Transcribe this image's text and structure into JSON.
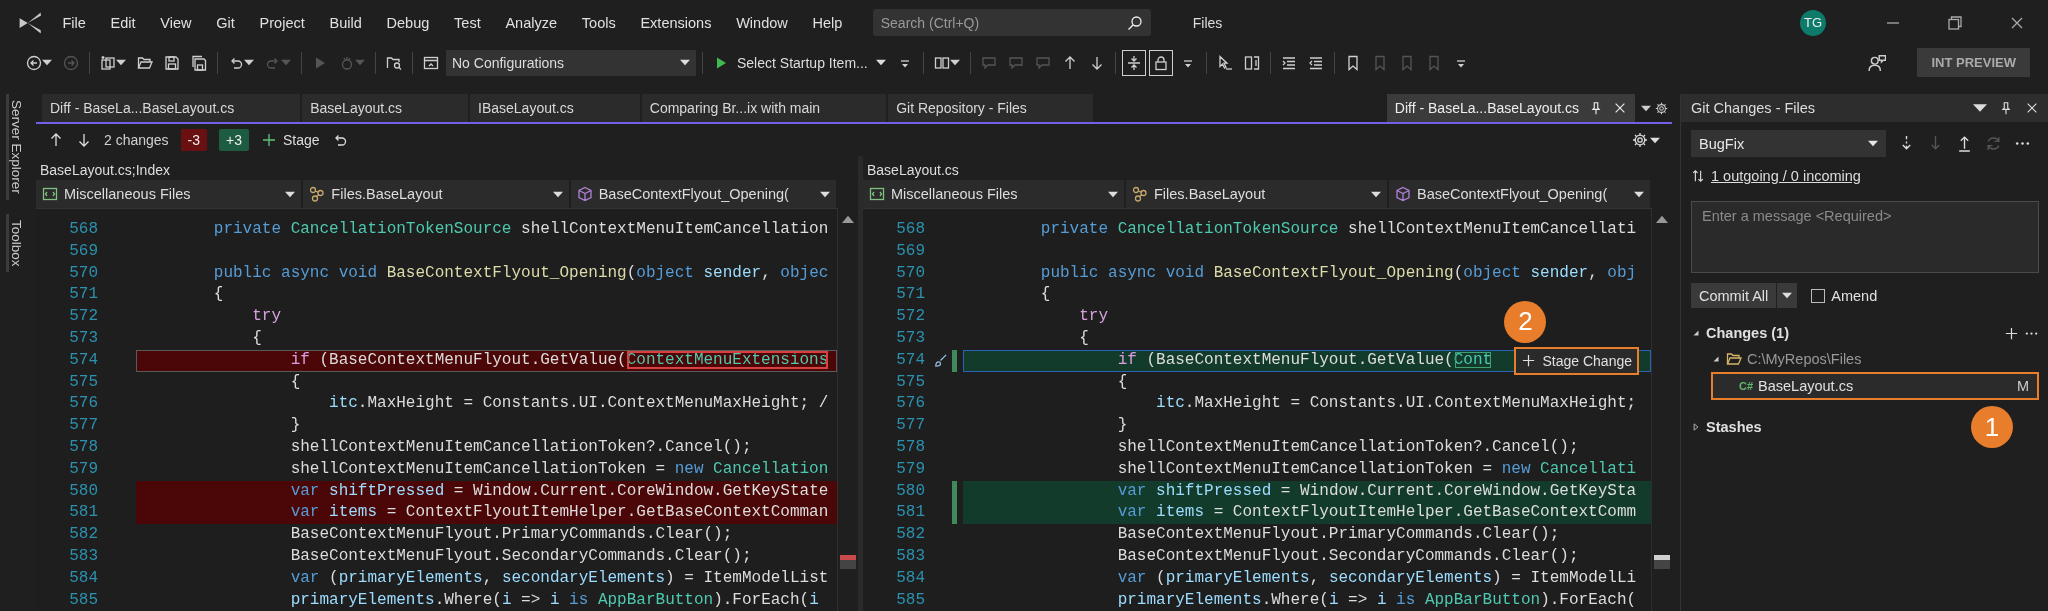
{
  "menu_bar": {
    "items": [
      "File",
      "Edit",
      "View",
      "Git",
      "Project",
      "Build",
      "Debug",
      "Test",
      "Analyze",
      "Tools",
      "Extensions",
      "Window",
      "Help"
    ],
    "search": {
      "placeholder": "Search (Ctrl+Q)"
    },
    "solution": "Files",
    "avatar": "TG"
  },
  "toolbar": {
    "items": [
      {
        "kind": "icon",
        "caret": true,
        "disabled": false
      },
      {
        "kind": "icon",
        "disabled": true
      },
      {
        "kind": "separator"
      },
      {
        "kind": "icon",
        "caret": true,
        "disabled": false
      },
      {
        "kind": "icon",
        "disabled": false
      },
      {
        "kind": "icon",
        "disabled": false
      },
      {
        "kind": "icon",
        "disabled": false
      },
      {
        "kind": "separator"
      },
      {
        "kind": "icon",
        "caret": true,
        "disabled": false
      },
      {
        "kind": "icon",
        "caret": true,
        "disabled": true
      },
      {
        "kind": "separator"
      },
      {
        "kind": "icon",
        "disabled": true
      },
      {
        "kind": "icon",
        "caret": true,
        "disabled": true
      },
      {
        "kind": "separator"
      },
      {
        "kind": "icon",
        "disabled": false
      },
      {
        "kind": "separator"
      },
      {
        "kind": "icon",
        "disabled": false
      },
      {
        "kind": "combo",
        "label": "No Configurations"
      },
      {
        "kind": "separator"
      },
      {
        "kind": "run",
        "label": "Select Startup Item..."
      },
      {
        "kind": "icon",
        "disabled": false
      },
      {
        "kind": "separator"
      },
      {
        "kind": "icon",
        "caret": true,
        "disabled": false
      },
      {
        "kind": "separator"
      },
      {
        "kind": "icon",
        "disabled": true
      },
      {
        "kind": "icon",
        "disabled": true
      },
      {
        "kind": "icon",
        "disabled": true
      },
      {
        "kind": "icon",
        "disabled": false
      },
      {
        "kind": "icon",
        "disabled": false
      },
      {
        "kind": "separator"
      },
      {
        "kind": "icon",
        "on": true,
        "disabled": false
      },
      {
        "kind": "icon",
        "on": true,
        "disabled": false
      },
      {
        "kind": "icon",
        "disabled": false
      },
      {
        "kind": "separator"
      },
      {
        "kind": "icon",
        "disabled": false
      },
      {
        "kind": "icon",
        "disabled": false
      },
      {
        "kind": "separator"
      },
      {
        "kind": "icon",
        "disabled": false
      },
      {
        "kind": "icon",
        "disabled": false
      },
      {
        "kind": "separator"
      },
      {
        "kind": "icon",
        "disabled": false
      },
      {
        "kind": "icon",
        "disabled": true
      },
      {
        "kind": "icon",
        "disabled": true
      },
      {
        "kind": "icon",
        "disabled": true
      },
      {
        "kind": "icon",
        "disabled": false
      }
    ],
    "preview_button": "INT PREVIEW"
  },
  "side_tabs": [
    "Server Explorer",
    "Toolbox"
  ],
  "document_tabs": [
    {
      "label": "Diff - BaseLa...BaseLayout.cs",
      "selected": false
    },
    {
      "label": "BaseLayout.cs",
      "selected": false
    },
    {
      "label": "IBaseLayout.cs",
      "selected": false
    },
    {
      "label": "Comparing Br...ix with main",
      "selected": false
    },
    {
      "label": "Git Repository - Files",
      "selected": false
    },
    {
      "label": "Diff - BaseLa...BaseLayout.cs",
      "selected": true,
      "pinned": true
    }
  ],
  "diff_toolbar": {
    "summary": "2 changes",
    "removed": "-3",
    "added": "+3",
    "stage": "Stage"
  },
  "panes": [
    {
      "title": "BaseLayout.cs;Index",
      "kind": "base",
      "active": false,
      "nav": [
        "Miscellaneous Files",
        "Files.BaseLayout",
        "BaseContextFlyout_Opening("
      ],
      "lines": [
        {
          "number": "568",
          "changed": false,
          "segments": [
            {
              "kind": "keyword",
              "text": "        private "
            },
            {
              "kind": "type",
              "text": "CancellationTokenSource"
            },
            {
              "kind": "plain",
              "text": " shellContextMenuItemCancellation"
            }
          ]
        },
        {
          "number": "569",
          "changed": false
        },
        {
          "number": "570",
          "changed": false,
          "segments": [
            {
              "kind": "keyword",
              "text": "        public async void "
            },
            {
              "kind": "method",
              "text": "BaseContextFlyout_Opening"
            },
            {
              "kind": "plain",
              "text": "("
            },
            {
              "kind": "keyword",
              "text": "object"
            },
            {
              "kind": "variable",
              "text": " sender"
            },
            {
              "kind": "plain",
              "text": ", "
            },
            {
              "kind": "keyword",
              "text": "objec"
            }
          ]
        },
        {
          "number": "571",
          "changed": false,
          "segments": [
            {
              "kind": "plain",
              "text": "        {"
            }
          ]
        },
        {
          "number": "572",
          "changed": false,
          "segments": [
            {
              "kind": "control",
              "text": "            try"
            }
          ]
        },
        {
          "number": "573",
          "changed": false,
          "segments": [
            {
              "kind": "plain",
              "text": "            {"
            }
          ]
        },
        {
          "number": "574",
          "changed": true,
          "current": true,
          "segments": [
            {
              "kind": "control",
              "text": "                if"
            },
            {
              "kind": "plain",
              "text": " (BaseContextMenuFlyout.GetValue("
            },
            {
              "kind": "boxed",
              "text": "ContextMenuExtensions"
            }
          ]
        },
        {
          "number": "575",
          "changed": false,
          "segments": [
            {
              "kind": "plain",
              "text": "                {"
            }
          ]
        },
        {
          "number": "576",
          "changed": false,
          "segments": [
            {
              "kind": "variable",
              "text": "                    itc"
            },
            {
              "kind": "plain",
              "text": ".MaxHeight = Constants.UI.ContextMenuMaxHeight; /"
            }
          ]
        },
        {
          "number": "577",
          "changed": false,
          "segments": [
            {
              "kind": "plain",
              "text": "                }"
            }
          ]
        },
        {
          "number": "578",
          "changed": false,
          "segments": [
            {
              "kind": "plain",
              "text": "                shellContextMenuItemCancellationToken?.Cancel();"
            }
          ]
        },
        {
          "number": "579",
          "changed": false,
          "segments": [
            {
              "kind": "plain",
              "text": "                shellContextMenuItemCancellationToken = "
            },
            {
              "kind": "keyword",
              "text": "new"
            },
            {
              "kind": "type",
              "text": " Cancellation"
            }
          ]
        },
        {
          "number": "580",
          "changed": true,
          "segments": [
            {
              "kind": "keyword",
              "text": "                var"
            },
            {
              "kind": "variable",
              "text": " shiftPressed"
            },
            {
              "kind": "plain",
              "text": " = Window.Current.CoreWindow.GetKeyState"
            }
          ]
        },
        {
          "number": "581",
          "changed": true,
          "segments": [
            {
              "kind": "keyword",
              "text": "                var"
            },
            {
              "kind": "variable",
              "text": " items"
            },
            {
              "kind": "plain",
              "text": " = ContextFlyoutItemHelper.GetBaseContextComman"
            }
          ]
        },
        {
          "number": "582",
          "changed": false,
          "segments": [
            {
              "kind": "plain",
              "text": "                BaseContextMenuFlyout.PrimaryCommands.Clear();"
            }
          ]
        },
        {
          "number": "583",
          "changed": false,
          "segments": [
            {
              "kind": "plain",
              "text": "                BaseContextMenuFlyout.SecondaryCommands.Clear();"
            }
          ]
        },
        {
          "number": "584",
          "changed": false,
          "segments": [
            {
              "kind": "keyword",
              "text": "                var"
            },
            {
              "kind": "plain",
              "text": " ("
            },
            {
              "kind": "variable",
              "text": "primaryElements"
            },
            {
              "kind": "plain",
              "text": ", "
            },
            {
              "kind": "variable",
              "text": "secondaryElements"
            },
            {
              "kind": "plain",
              "text": ") = ItemModelList"
            }
          ]
        },
        {
          "number": "585",
          "changed": false,
          "segments": [
            {
              "kind": "variable",
              "text": "                primaryElements"
            },
            {
              "kind": "plain",
              "text": ".Where("
            },
            {
              "kind": "variable",
              "text": "i"
            },
            {
              "kind": "plain",
              "text": " => "
            },
            {
              "kind": "variable",
              "text": "i"
            },
            {
              "kind": "keyword",
              "text": " is"
            },
            {
              "kind": "type",
              "text": " AppBarButton"
            },
            {
              "kind": "plain",
              "text": ").ForEach("
            },
            {
              "kind": "variable",
              "text": "i"
            }
          ]
        }
      ]
    },
    {
      "title": "BaseLayout.cs",
      "kind": "modified",
      "active": true,
      "nav": [
        "Miscellaneous Files",
        "Files.BaseLayout",
        "BaseContextFlyout_Opening("
      ],
      "lines": [
        {
          "number": "568",
          "changed": false,
          "segments": [
            {
              "kind": "keyword",
              "text": "        private "
            },
            {
              "kind": "type",
              "text": "CancellationTokenSource"
            },
            {
              "kind": "plain",
              "text": " shellContextMenuItemCancellati"
            }
          ]
        },
        {
          "number": "569",
          "changed": false
        },
        {
          "number": "570",
          "changed": false,
          "segments": [
            {
              "kind": "keyword",
              "text": "        public async void "
            },
            {
              "kind": "method",
              "text": "BaseContextFlyout_Opening"
            },
            {
              "kind": "plain",
              "text": "("
            },
            {
              "kind": "keyword",
              "text": "object"
            },
            {
              "kind": "variable",
              "text": " sender"
            },
            {
              "kind": "plain",
              "text": ", "
            },
            {
              "kind": "keyword",
              "text": "obj"
            }
          ]
        },
        {
          "number": "571",
          "changed": false,
          "segments": [
            {
              "kind": "plain",
              "text": "        {"
            }
          ]
        },
        {
          "number": "572",
          "changed": false,
          "segments": [
            {
              "kind": "control",
              "text": "            try"
            }
          ]
        },
        {
          "number": "573",
          "changed": false,
          "segments": [
            {
              "kind": "plain",
              "text": "            {"
            }
          ]
        },
        {
          "number": "574",
          "changed": true,
          "current": true,
          "segments": [
            {
              "kind": "control",
              "text": "                if"
            },
            {
              "kind": "plain",
              "text": " (BaseContextMenuFlyout.GetValue("
            },
            {
              "kind": "boxed",
              "text": "Cont"
            }
          ],
          "stage_change": {
            "label": "Stage Change",
            "highlighted": true,
            "callout": "2"
          }
        },
        {
          "number": "575",
          "changed": false,
          "segments": [
            {
              "kind": "plain",
              "text": "                {"
            }
          ]
        },
        {
          "number": "576",
          "changed": false,
          "segments": [
            {
              "kind": "variable",
              "text": "                    itc"
            },
            {
              "kind": "plain",
              "text": ".MaxHeight = Constants.UI.ContextMenuMaxHeight;"
            }
          ]
        },
        {
          "number": "577",
          "changed": false,
          "segments": [
            {
              "kind": "plain",
              "text": "                }"
            }
          ]
        },
        {
          "number": "578",
          "changed": false,
          "segments": [
            {
              "kind": "plain",
              "text": "                shellContextMenuItemCancellationToken?.Cancel();"
            }
          ]
        },
        {
          "number": "579",
          "changed": false,
          "segments": [
            {
              "kind": "plain",
              "text": "                shellContextMenuItemCancellationToken = "
            },
            {
              "kind": "keyword",
              "text": "new"
            },
            {
              "kind": "type",
              "text": " Cancellati"
            }
          ]
        },
        {
          "number": "580",
          "changed": true,
          "segments": [
            {
              "kind": "keyword",
              "text": "                var"
            },
            {
              "kind": "variable",
              "text": " shiftPressed"
            },
            {
              "kind": "plain",
              "text": " = Window.Current.CoreWindow.GetKeySta"
            }
          ]
        },
        {
          "number": "581",
          "changed": true,
          "segments": [
            {
              "kind": "keyword",
              "text": "                var"
            },
            {
              "kind": "variable",
              "text": " items"
            },
            {
              "kind": "plain",
              "text": " = ContextFlyoutItemHelper.GetBaseContextComm"
            }
          ]
        },
        {
          "number": "582",
          "changed": false,
          "segments": [
            {
              "kind": "plain",
              "text": "                BaseContextMenuFlyout.PrimaryCommands.Clear();"
            }
          ]
        },
        {
          "number": "583",
          "changed": false,
          "segments": [
            {
              "kind": "plain",
              "text": "                BaseContextMenuFlyout.SecondaryCommands.Clear();"
            }
          ]
        },
        {
          "number": "584",
          "changed": false,
          "segments": [
            {
              "kind": "keyword",
              "text": "                var"
            },
            {
              "kind": "plain",
              "text": " ("
            },
            {
              "kind": "variable",
              "text": "primaryElements"
            },
            {
              "kind": "plain",
              "text": ", "
            },
            {
              "kind": "variable",
              "text": "secondaryElements"
            },
            {
              "kind": "plain",
              "text": ") = ItemModelLi"
            }
          ]
        },
        {
          "number": "585",
          "changed": false,
          "segments": [
            {
              "kind": "variable",
              "text": "                primaryElements"
            },
            {
              "kind": "plain",
              "text": ".Where("
            },
            {
              "kind": "variable",
              "text": "i"
            },
            {
              "kind": "plain",
              "text": " => "
            },
            {
              "kind": "variable",
              "text": "i"
            },
            {
              "kind": "keyword",
              "text": " is"
            },
            {
              "kind": "type",
              "text": " AppBarButton"
            },
            {
              "kind": "plain",
              "text": ").ForEach("
            }
          ]
        }
      ]
    }
  ],
  "git_changes": {
    "title": "Git Changes - Files",
    "branch": "BugFix",
    "actions": [
      {
        "disabled": false
      },
      {
        "disabled": true
      },
      {
        "disabled": false
      },
      {
        "disabled": true
      },
      {
        "disabled": false
      }
    ],
    "sync_status": "1 outgoing / 0 incoming",
    "message": {
      "placeholder": "Enter a message <Required>"
    },
    "commit": "Commit All",
    "amend": {
      "label": "Amend",
      "checked": false
    },
    "changes": {
      "label": "Changes (1)",
      "expanded": true,
      "children": [
        {
          "label": "C:\\MyRepos\\Files",
          "expanded": true,
          "children": [
            {
              "label": "BaseLayout.cs",
              "badge": "C#",
              "status": "M",
              "highlighted": true,
              "callout": "1"
            }
          ]
        }
      ]
    },
    "stashes": {
      "label": "Stashes",
      "expanded": false
    }
  }
}
